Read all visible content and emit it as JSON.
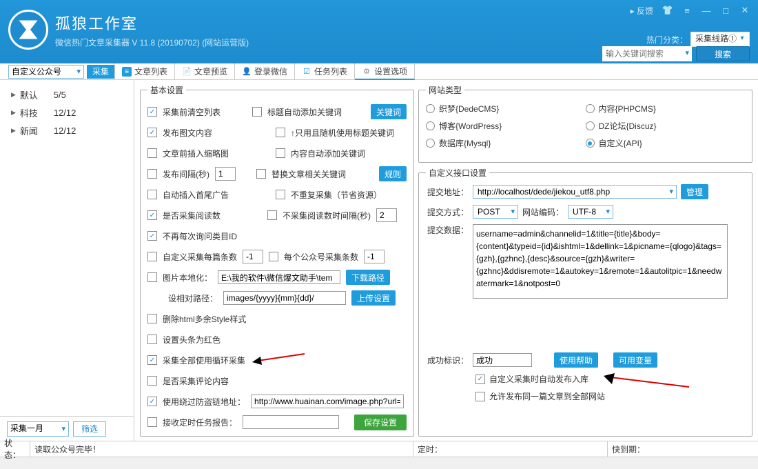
{
  "header": {
    "app_title": "孤狼工作室",
    "subtitle": "微信热门文章采集器  V 11.8 (20190702) (网站运营版)",
    "feedback": "▸ 反馈",
    "hot_label": "热门分类：",
    "hot_value": "采集线路①",
    "search_placeholder": "输入关键词搜索",
    "search_btn": "搜索"
  },
  "toolbar": {
    "source_combo": "自定义公众号",
    "collect_btn": "采集",
    "tabs": [
      {
        "label": "文章列表"
      },
      {
        "label": "文章预览"
      },
      {
        "label": "登录微信"
      },
      {
        "label": "任务列表"
      },
      {
        "label": "设置选项"
      }
    ]
  },
  "sidebar": {
    "items": [
      {
        "label": "默认",
        "count": "5/5"
      },
      {
        "label": "科技",
        "count": "12/12"
      },
      {
        "label": "新闻",
        "count": "12/12"
      }
    ],
    "month_combo": "采集一月",
    "filter_btn": "筛选"
  },
  "basic": {
    "legend": "基本设置",
    "cb_clear": "采集前清空列表",
    "cb_autokw": "标题自动添加关键词",
    "btn_kw": "关键词",
    "cb_pubimg": "发布图文内容",
    "cb_onlyrand": "↑只用且随机使用标题关键词",
    "cb_thumb": "文章前插入缩略图",
    "cb_bodykw": "内容自动添加关键词",
    "cb_interval": "发布间隔(秒)",
    "interval_val": "1",
    "cb_replace": "替换文章相关关键词",
    "btn_rule": "规则",
    "cb_headad": "自动插入首尾广告",
    "cb_norepeat": "不重复采集（节省资源）",
    "cb_readcount": "是否采集阅读数",
    "cb_nointerval": "不采集阅读数时间隔(秒)",
    "noint_val": "2",
    "cb_noask": "不再每次询问类目ID",
    "cb_perart": "自定义采集每篇条数",
    "perart_val": "-1",
    "cb_pergzh": "每个公众号采集条数",
    "pergzh_val": "-1",
    "lbl_local": "图片本地化：",
    "local_val": "E:\\我的软件\\微信爆文助手\\tem",
    "btn_dlpath": "下载路径",
    "lbl_rel": "设相对路径：",
    "rel_val": "images/{yyyy}{mm}{dd}/",
    "btn_upset": "上传设置",
    "cb_delstyle": "删除html多余Style样式",
    "cb_redhead": "设置头条为红色",
    "cb_loopall": "采集全部使用循环采集",
    "cb_comments": "是否采集评论内容",
    "cb_bypass": "使用绕过防盗链地址：",
    "bypass_val": "http://www.huainan.com/image.php?url=",
    "cb_sched": "接收定时任务报告：",
    "btn_save": "保存设置"
  },
  "site": {
    "legend": "网站类型",
    "opts": [
      "织梦{DedeCMS}",
      "内容{PHPCMS}",
      "博客{WordPress}",
      "DZ论坛{Discuz}",
      "数据库{Mysql}",
      "自定义{API}"
    ]
  },
  "api": {
    "legend": "自定义接口设置",
    "lbl_url": "提交地址：",
    "url_val": "http://localhost/dede/jiekou_utf8.php",
    "btn_manage": "管理",
    "lbl_method": "提交方式：",
    "method_val": "POST",
    "lbl_enc": "网站编码：",
    "enc_val": "UTF-8",
    "lbl_data": "提交数据：",
    "data_val": "username=admin&channelid=1&title={title}&body={content}&typeid={id}&ishtml=1&dellink=1&picname={qlogo}&tags={gzh},{gzhnc},{desc}&source={gzh}&writer={gzhnc}&ddisremote=1&autokey=1&remote=1&autolitpic=1&needwatermark=1&notpost=0",
    "lbl_succ": "成功标识：",
    "succ_val": "成功",
    "btn_help": "使用帮助",
    "btn_vars": "可用变量",
    "cb_autopub": "自定义采集时自动发布入库",
    "cb_allowdup": "允许发布同一篇文章到全部网站"
  },
  "status": {
    "label": "状态：",
    "msg": "读取公众号完毕！",
    "timer_label": "定时：",
    "expire_label": "快到期："
  }
}
